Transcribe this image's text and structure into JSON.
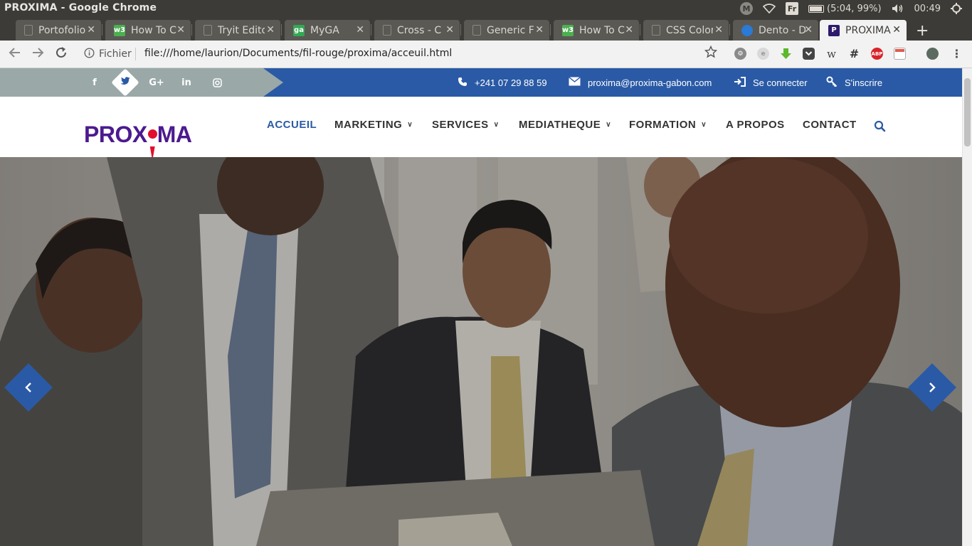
{
  "os": {
    "window_title": "PROXIMA - Google Chrome",
    "keyboard_layout": "Fr",
    "battery": "(5:04, 99%)",
    "clock": "00:49",
    "mail_indicator": "M"
  },
  "tabs": [
    {
      "title": "Portofolio",
      "favicon": "page-icon",
      "color": "#5a5954"
    },
    {
      "title": "How To C",
      "favicon": "w3-icon",
      "color": "#4caf50"
    },
    {
      "title": "Tryit Editor",
      "favicon": "page-icon",
      "color": "#5a5954"
    },
    {
      "title": "MyGA",
      "favicon": "ga-icon",
      "color": "#34a853"
    },
    {
      "title": "Cross - C",
      "favicon": "leaf-icon",
      "color": "#5a5954"
    },
    {
      "title": "Generic F",
      "favicon": "page-icon",
      "color": "#5a5954"
    },
    {
      "title": "How To C",
      "favicon": "w3-icon",
      "color": "#4caf50"
    },
    {
      "title": "CSS Colors",
      "favicon": "page-icon",
      "color": "#5a5954"
    },
    {
      "title": "Dento - D",
      "favicon": "tooth-icon",
      "color": "#2a7ad6"
    },
    {
      "title": "PROXIMA",
      "favicon": "proxima-icon",
      "color": "#2d1a6b",
      "active": true
    }
  ],
  "browser": {
    "url_prefix": "Fichier",
    "url": "file:///home/laurion/Documents/fil-rouge/proxima/acceuil.html"
  },
  "site": {
    "phone": "+241 07 29 88 59",
    "email": "proxima@proxima-gabon.com",
    "login": "Se connecter",
    "register": "S'inscrire",
    "logo_left": "PROX",
    "logo_right": "MA",
    "menu": [
      {
        "label": "ACCUEIL",
        "active": true,
        "dropdown": false
      },
      {
        "label": "MARKETING",
        "dropdown": true
      },
      {
        "label": "SERVICES",
        "dropdown": true
      },
      {
        "label": "MEDIATHEQUE",
        "dropdown": true
      },
      {
        "label": "FORMATION",
        "dropdown": true
      },
      {
        "label": "A PROPOS",
        "dropdown": false
      },
      {
        "label": "CONTACT",
        "dropdown": false
      }
    ],
    "social": [
      "f",
      "twitter",
      "G+",
      "in",
      "instagram"
    ]
  },
  "colors": {
    "primary_blue": "#2a5aa5",
    "logo_purple": "#4b1a8f",
    "logo_red": "#e0102c",
    "social_bar_gray": "#9aa8a8"
  }
}
